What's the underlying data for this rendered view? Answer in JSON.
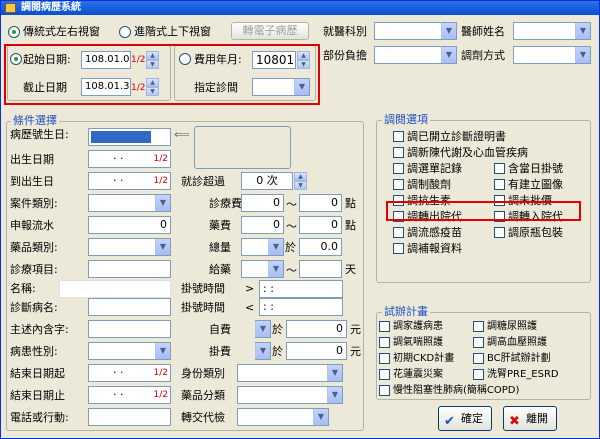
{
  "window": {
    "title": "調閱病歷系統"
  },
  "top": {
    "radio_lr": "傳統式左右視窗",
    "radio_tb": "進階式上下視窗",
    "e_chart": "轉電子病歷",
    "start_label": "起始日期:",
    "start_value": "108.01.01",
    "start_mark": "1/2",
    "end_label": "截止日期",
    "end_value": "108.01.31",
    "end_mark": "1/2",
    "fee_label": "費用年月:",
    "fee_value": "10801",
    "clinic_label": "指定診間",
    "dept_label": "就醫科別",
    "doctor_label": "醫師姓名",
    "section_label": "部份負擔",
    "prescribe_label": "調劑方式"
  },
  "conditions": {
    "title": "條件選擇",
    "chart_no": "病歷號生日:",
    "birth_date": "出生日期",
    "to_birth": "到出生日",
    "birth_mark": "1/2",
    "birth_to_mark": "1/2",
    "date_dots": "·  ·",
    "case_type": "案件類別:",
    "report_no": "申報流水",
    "report_value": "0",
    "drug_type": "藥品類別:",
    "diag_item": "診療項目:",
    "name": "名稱:",
    "diag_name": "診斷病名:",
    "main_contains": "主述內含字:",
    "gender": "病患性別:",
    "end_from": "結束日期起",
    "end_to": "結束日期止",
    "dots": "·  ·",
    "mark": "1/2",
    "phone": "電話或行動:",
    "revisit": "就診超過",
    "revisit_value": "0 次",
    "diag_fee": "診療費",
    "drug_fee": "藥費",
    "total": "總量",
    "give_days": "給藥",
    "fee_v1": "0",
    "fee_v2": "0",
    "fee_v3": "0",
    "fee_v4": "0",
    "total_v": "0.0",
    "unit_point": "點",
    "unit_point2": "點",
    "unit_day": "天",
    "ge": "於",
    "reg_time": "掛號時間",
    "gt": ">",
    "lt": "<",
    "time": "  :  :",
    "self_pay": "自費",
    "self_v": "0",
    "reg_fee": "掛費",
    "reg_v": "0",
    "unit_yuan": "元",
    "unit_yuan2": "元",
    "identity": "身份類別",
    "drug_class": "藥品分類",
    "referral": "轉交代檢",
    "ge2": "於",
    "ge3": "於"
  },
  "options": {
    "title": "調閱選項",
    "items": [
      "調已開立診斷證明書",
      "調新陳代謝及心血管疾病",
      "調選單記錄",
      "含當日掛號",
      "調制酸劑",
      "有建立圖像",
      "調抗生素",
      "調未批價",
      "調轉出院代",
      "調轉入院代",
      "調流感疫苗",
      "調原瓶包裝",
      "調補報資料"
    ]
  },
  "trial": {
    "title": "試辦計畫",
    "items": [
      "調家護病患",
      "調糖尿照護",
      "調氣喘照護",
      "調高血壓照護",
      "初期CKD計畫",
      "BC肝試辦計劃",
      "花蓮震災案",
      "洗腎PRE_ESRD",
      "慢性阻塞性肺病(簡稱COPD)"
    ]
  },
  "buttons": {
    "ok": "確定",
    "exit": "離開"
  },
  "colors": {
    "title_bar": "#0a4ed3",
    "group_title": "#1d4fc3",
    "highlight": "#e00000"
  }
}
